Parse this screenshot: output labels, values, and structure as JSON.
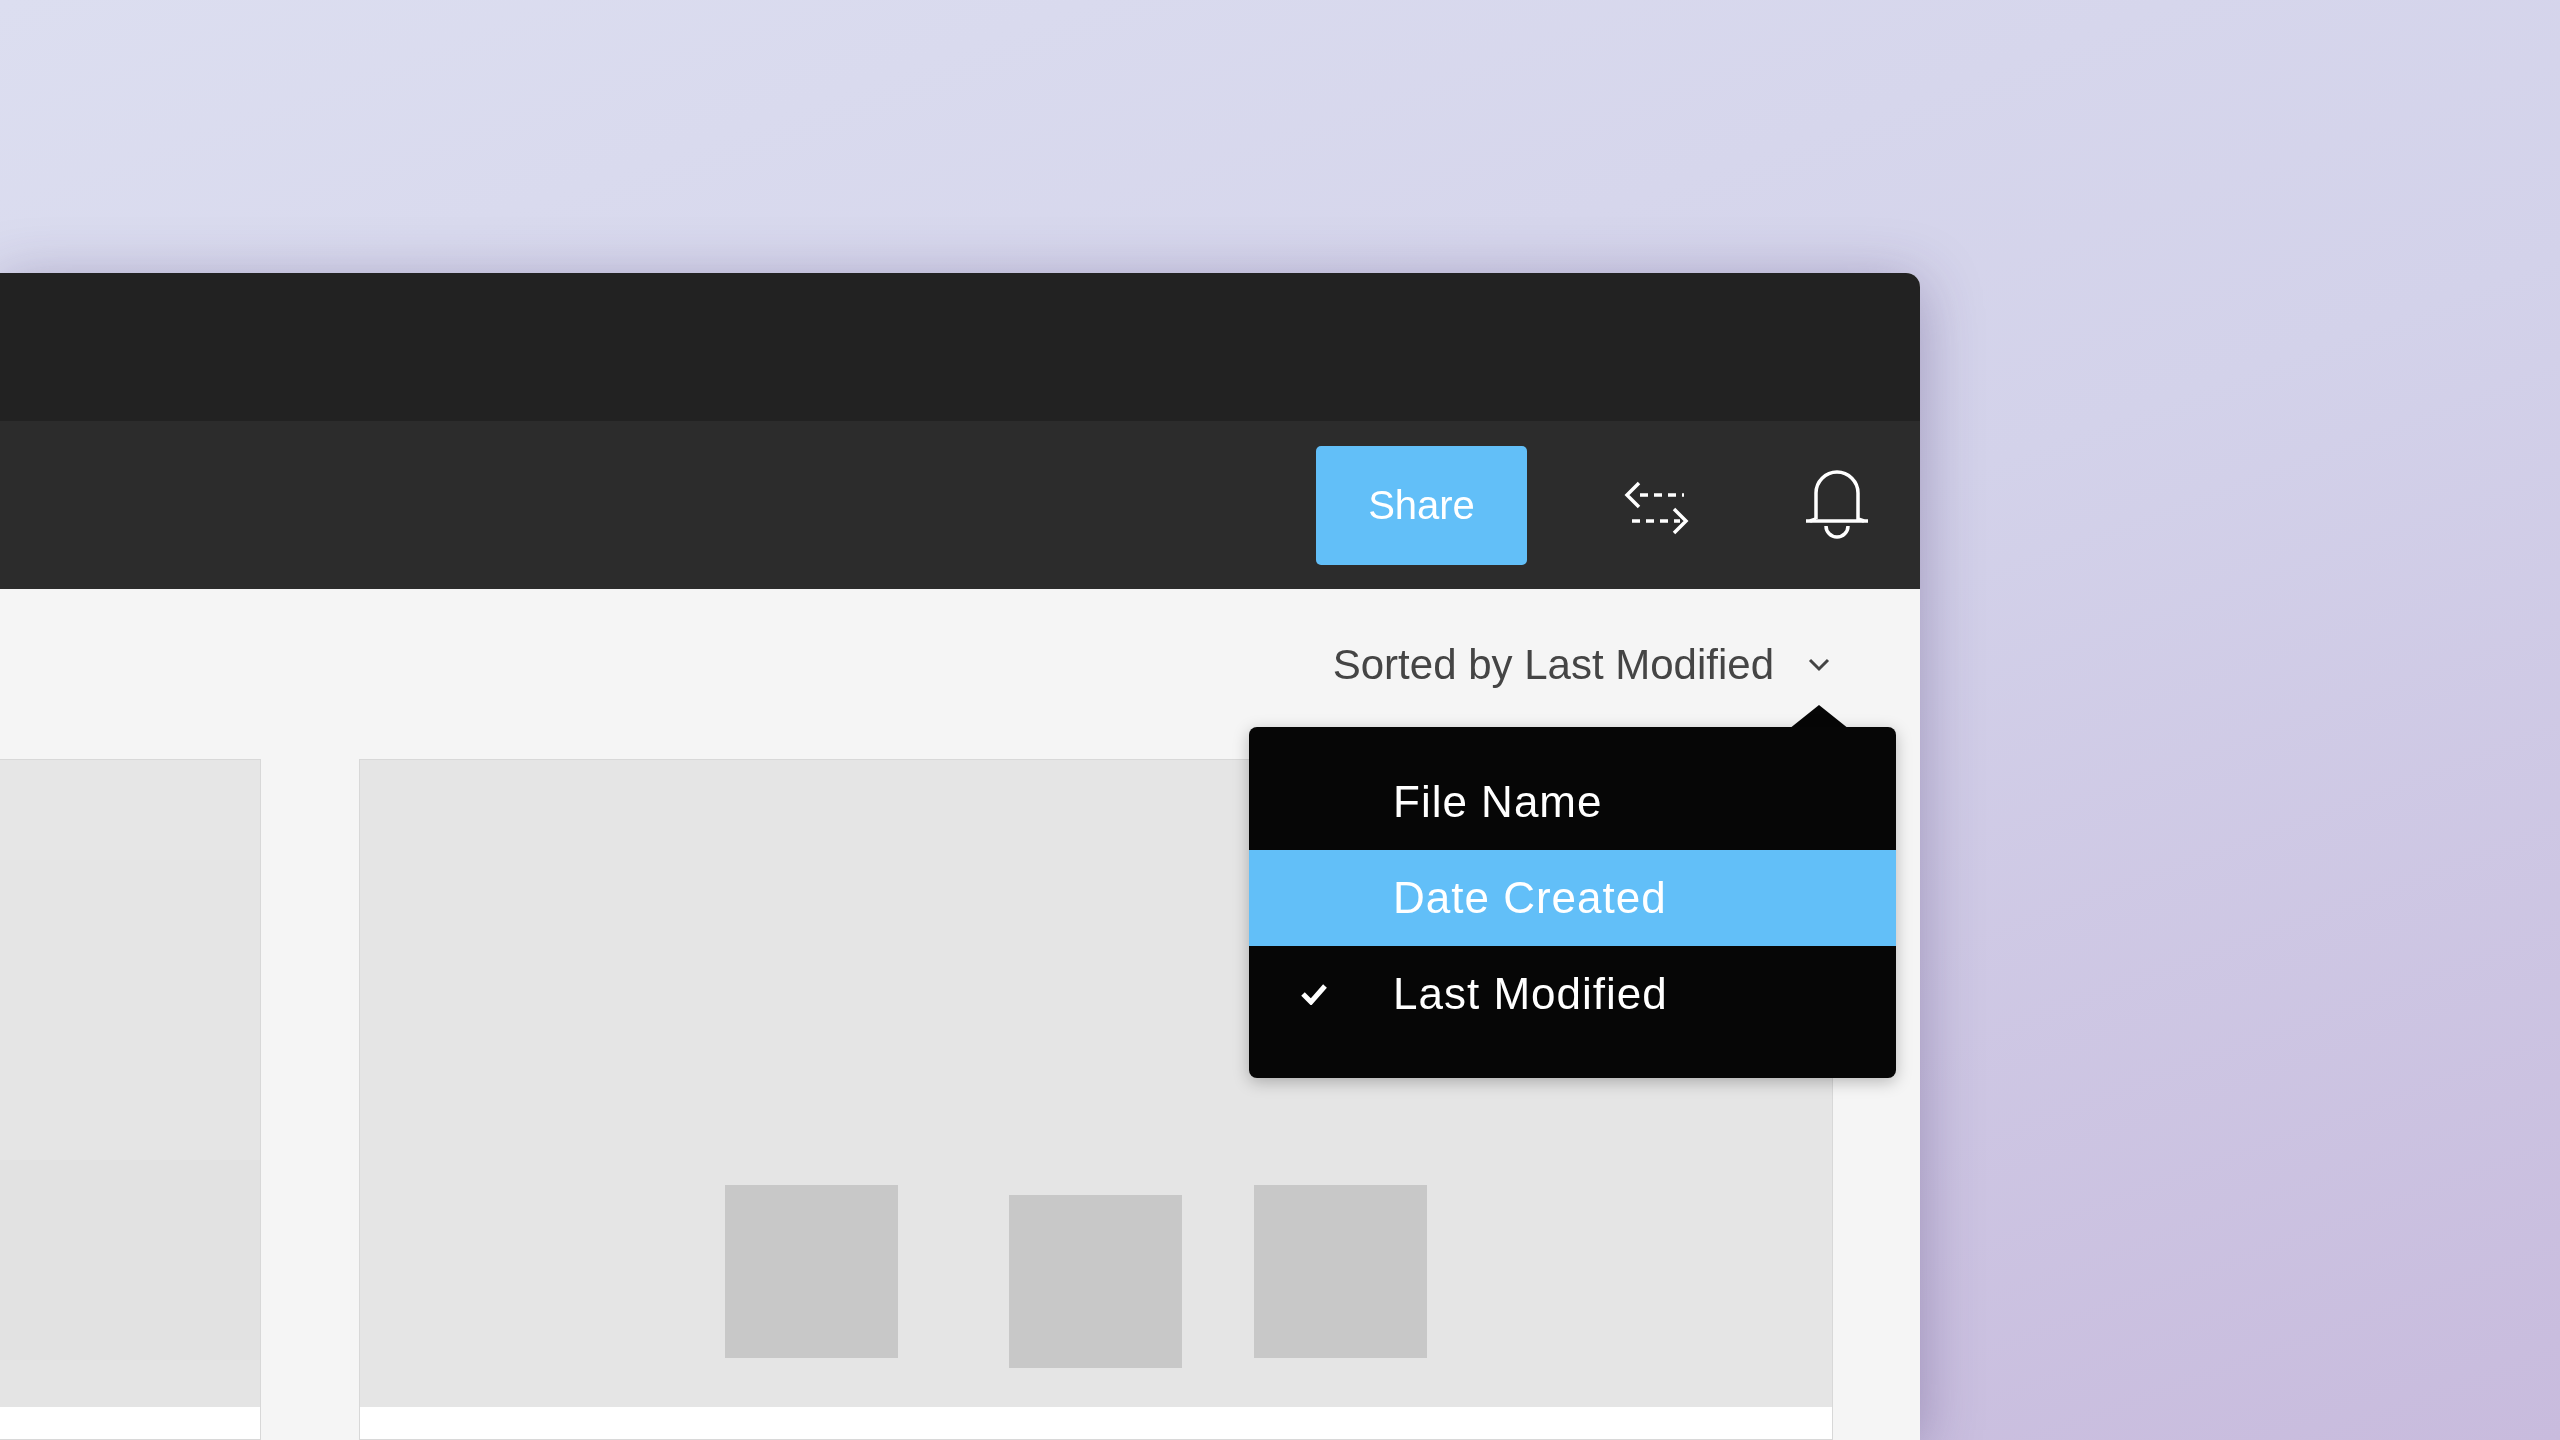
{
  "toolbar": {
    "share_button": "Share"
  },
  "sort": {
    "label": "Sorted by Last Modified",
    "expanded": true
  },
  "sort_menu": [
    {
      "label": "File Name",
      "checked": false,
      "highlighted": false
    },
    {
      "label": "Date Created",
      "checked": false,
      "highlighted": true
    },
    {
      "label": "Last Modified",
      "checked": true,
      "highlighted": false
    }
  ],
  "cards": [
    {
      "kind": "picture"
    },
    {
      "kind": "thumbnails"
    }
  ]
}
